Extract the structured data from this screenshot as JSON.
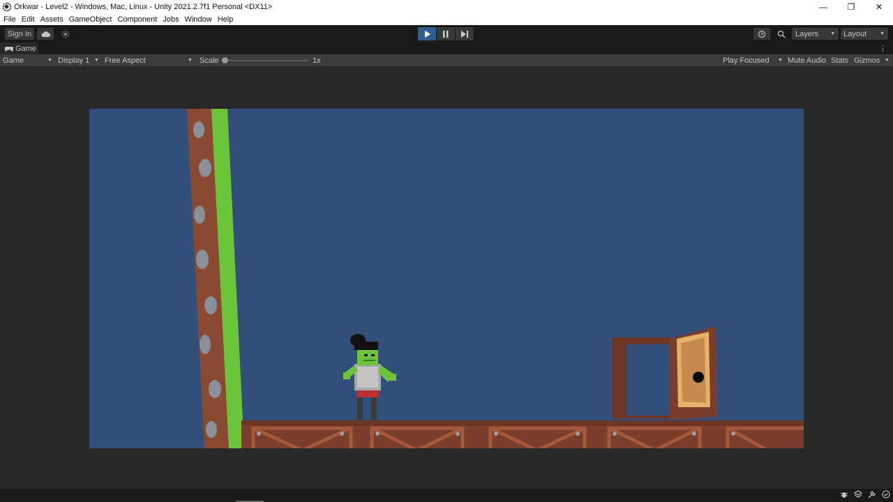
{
  "window": {
    "title": "Orkwar - Level2 - Windows, Mac, Linux - Unity 2021.2.7f1 Personal <DX11>",
    "controls": {
      "minimize": "—",
      "restore": "❐",
      "close": "✕"
    }
  },
  "menu": [
    "File",
    "Edit",
    "Assets",
    "GameObject",
    "Component",
    "Jobs",
    "Window",
    "Help"
  ],
  "toolbar": {
    "sign_in": "Sign In",
    "cloud_icon": "cloud-icon",
    "collab_icon": "collab-icon",
    "play_icon": "▶",
    "pause_icon": "❚❚",
    "step_icon": "▶|",
    "history_icon": "history-icon",
    "search_icon": "search-icon",
    "layers": "Layers",
    "layout": "Layout"
  },
  "tab": {
    "label": "Game",
    "menu": "⋮"
  },
  "game_controls": {
    "mode": "Game",
    "display": "Display 1",
    "aspect": "Free Aspect",
    "scale_label": "Scale",
    "scale_value": "1x",
    "scale_level": 0,
    "play_mode": "Play Focused",
    "mute": "Mute Audio",
    "stats": "Stats",
    "gizmos": "Gizmos"
  },
  "status_icons": [
    "bug-icon",
    "layers-icon",
    "build-icon",
    "check-icon"
  ],
  "colors": {
    "sky": "#344e7a",
    "ground": "#7a3e2c",
    "ground_dark": "#5e2e22",
    "vine": "#6cc43a",
    "door": "#c98a4e",
    "accent": "#2f5e8e"
  }
}
